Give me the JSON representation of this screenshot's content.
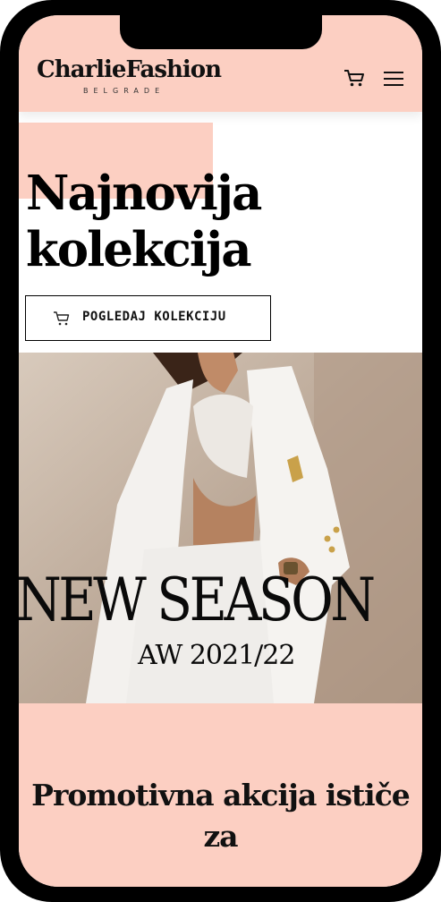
{
  "header": {
    "brand": "CharlieFashion",
    "city": "BELGRADE",
    "cart_icon": "cart-icon",
    "menu_icon": "hamburger-menu-icon"
  },
  "hero": {
    "title": "Najnovija kolekcija",
    "cta_label": "POGLEDAJ KOLEKCIJU",
    "cta_icon": "cart-icon"
  },
  "banner": {
    "title": "NEW SEASON",
    "subtitle": "AW 2021/22"
  },
  "promo": {
    "title": "Promotivna akcija ističe za"
  },
  "colors": {
    "accent": "#fccfc2",
    "text": "#000000",
    "frame": "#000000"
  }
}
